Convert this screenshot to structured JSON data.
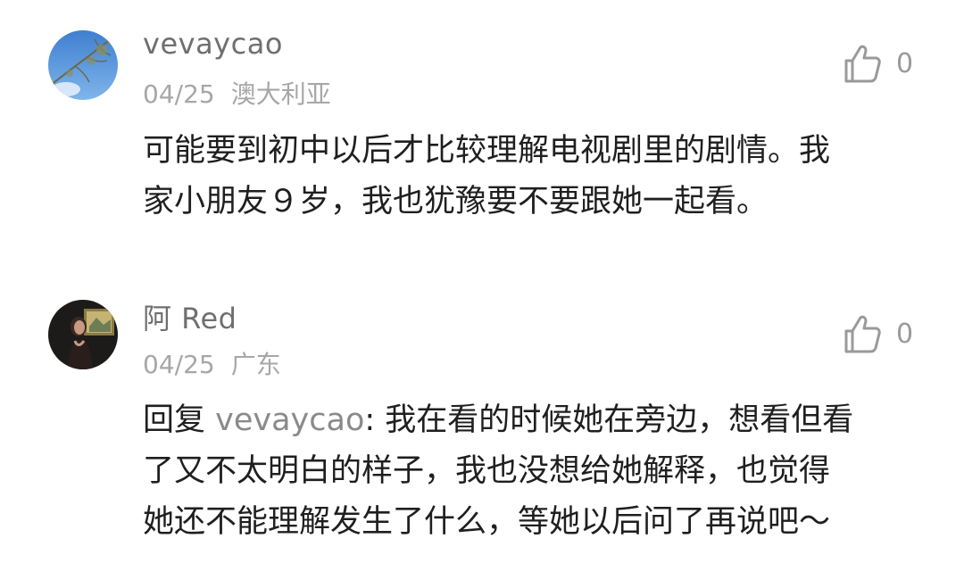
{
  "comments": [
    {
      "username": "vevaycao",
      "date": "04/25",
      "location": "澳大利亚",
      "likes": "0",
      "text_lines": [
        "可能要到初中以后才比较理解电视剧里的剧情。我",
        "家小朋友９岁，我也犹豫要不要跟她一起看。"
      ],
      "avatar_icon": "sky-branches-avatar"
    },
    {
      "username": "阿 Red",
      "date": "04/25",
      "location": "广东",
      "likes": "0",
      "reply": {
        "prefix": "回复 ",
        "to": "vevaycao",
        "colon": ": "
      },
      "text_first_line": "我在看的时候她在旁边，想看但看",
      "text_lines": [
        "了又不太明白的样子，我也没想给她解释，也觉得",
        "她还不能理解发生了什么，等她以后问了再说吧～"
      ],
      "avatar_icon": "portrait-avatar"
    }
  ],
  "icons": {
    "like": "thumbs-up-icon"
  }
}
